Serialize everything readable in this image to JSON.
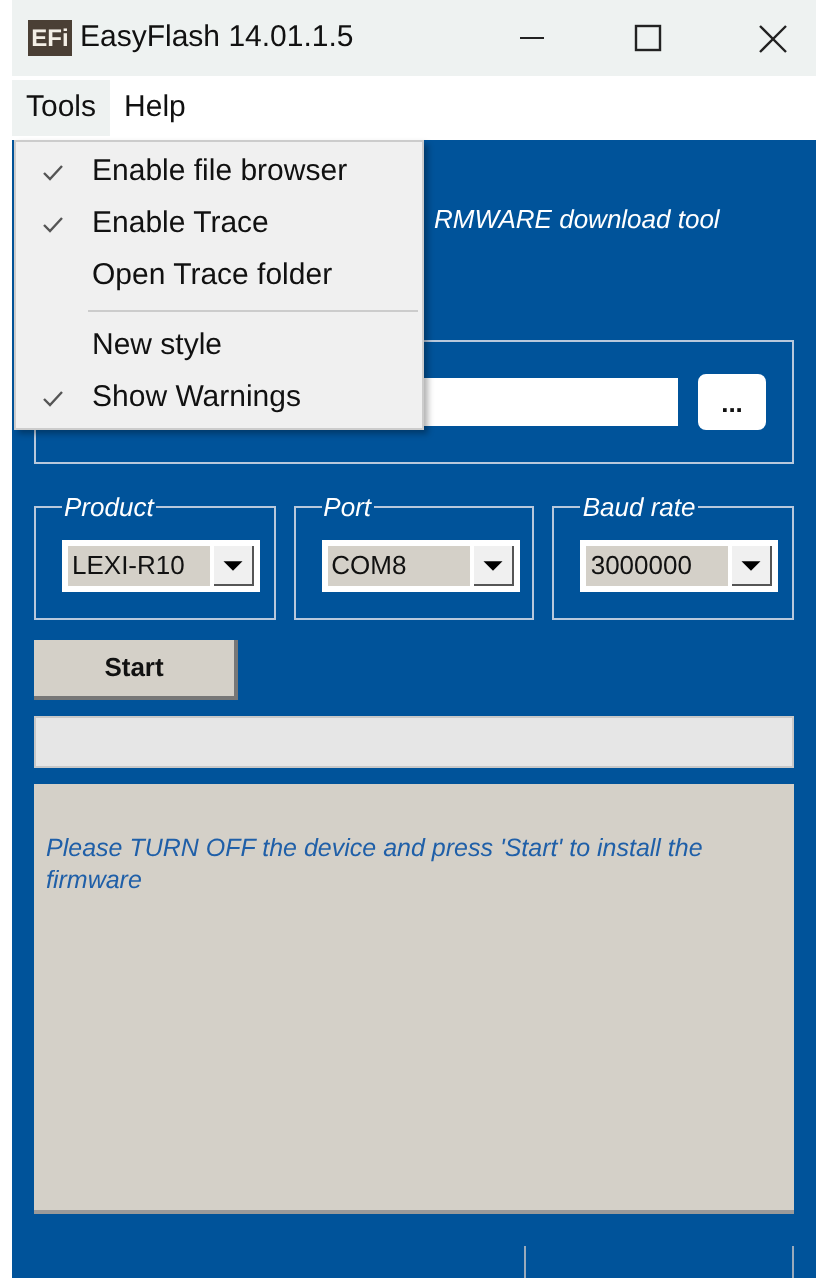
{
  "window": {
    "icon_label": "EFi",
    "title": "EasyFlash 14.01.1.5"
  },
  "menu_bar": [
    {
      "label": "Tools",
      "selected": true
    },
    {
      "label": "Help",
      "selected": false
    }
  ],
  "tools_menu": [
    {
      "kind": "item",
      "label": "Enable file browser",
      "checked": true
    },
    {
      "kind": "item",
      "label": "Enable Trace",
      "checked": true
    },
    {
      "kind": "item",
      "label": "Open Trace folder",
      "checked": false
    },
    {
      "kind": "separator"
    },
    {
      "kind": "item",
      "label": "New style",
      "checked": false
    },
    {
      "kind": "item",
      "label": "Show Warnings",
      "checked": true
    }
  ],
  "subtitle": "RMWARE download tool",
  "file_group": {
    "browse_button": "..."
  },
  "selectors": [
    {
      "label": "Product",
      "value": "LEXI-R10"
    },
    {
      "label": "Port",
      "value": "COM8"
    },
    {
      "label": "Baud rate",
      "value": "3000000"
    }
  ],
  "start_button": "Start",
  "progress": {
    "level": 0
  },
  "message": "Please TURN OFF the device and press 'Start' to install the firmware"
}
